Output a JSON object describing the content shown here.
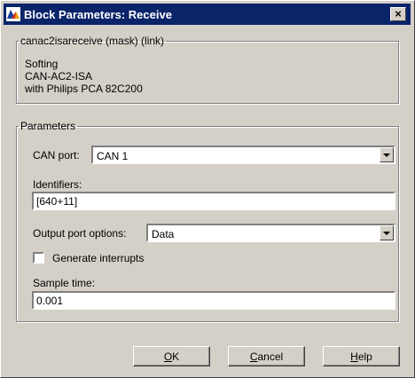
{
  "window": {
    "title": "Block Parameters: Receive",
    "close_symbol": "×"
  },
  "mask_group": {
    "legend": "canac2isareceive (mask) (link)",
    "description_lines": [
      "Softing",
      "CAN-AC2-ISA",
      "with Philips PCA 82C200"
    ]
  },
  "params_group": {
    "legend": "Parameters",
    "can_port": {
      "label": "CAN port:",
      "value": "CAN 1"
    },
    "identifiers": {
      "label": "Identifiers:",
      "value": "[640+11]"
    },
    "output_port_options": {
      "label": "Output port options:",
      "value": "Data"
    },
    "generate_interrupts": {
      "label": "Generate interrupts",
      "checked": false
    },
    "sample_time": {
      "label": "Sample time:",
      "value": "0.001"
    }
  },
  "buttons": {
    "ok": {
      "mnemonic": "O",
      "rest": "K"
    },
    "cancel": {
      "mnemonic": "C",
      "rest": "ancel"
    },
    "help": {
      "mnemonic": "H",
      "rest": "elp"
    }
  },
  "icons": {
    "app": "matlab-simulink-icon",
    "dropdown": "chevron-down-icon"
  }
}
